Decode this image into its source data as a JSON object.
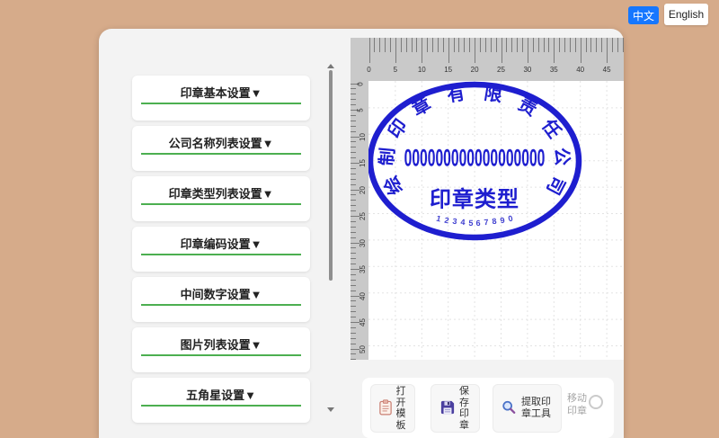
{
  "language_switcher": {
    "chinese_label": "中文",
    "english_label": "English",
    "active_color": "#1677ff"
  },
  "sidebar": {
    "accent_color": "#4caf50",
    "sections": [
      {
        "name": "stamp-basic-settings",
        "label": "印章基本设置▼"
      },
      {
        "name": "company-name-list-settings",
        "label": "公司名称列表设置▼"
      },
      {
        "name": "stamp-type-list-settings",
        "label": "印章类型列表设置▼"
      },
      {
        "name": "stamp-code-settings",
        "label": "印章编码设置▼"
      },
      {
        "name": "middle-number-settings",
        "label": "中间数字设置▼"
      },
      {
        "name": "image-list-settings",
        "label": "图片列表设置▼"
      },
      {
        "name": "star-settings",
        "label": "五角星设置▼"
      }
    ]
  },
  "canvas": {
    "ruler": {
      "top_labels": [
        "0",
        "5",
        "10",
        "15",
        "20",
        "25",
        "30",
        "35",
        "40",
        "45"
      ],
      "left_labels": [
        "0",
        "5",
        "10",
        "15",
        "20",
        "25",
        "30",
        "35",
        "40",
        "45",
        "50"
      ]
    },
    "stamp": {
      "company_text": "绘制印章有限责任公司",
      "middle_code": "000000000000000000",
      "type_text": "印章类型",
      "bottom_digits": "1234567890",
      "ink_color": "#1e1ecf"
    }
  },
  "toolbar": {
    "open_template_label": "打开模板",
    "save_stamp_label": "保存印章",
    "extract_tool_label": "提取印章工具",
    "move_stamp_label": "移动印章"
  }
}
